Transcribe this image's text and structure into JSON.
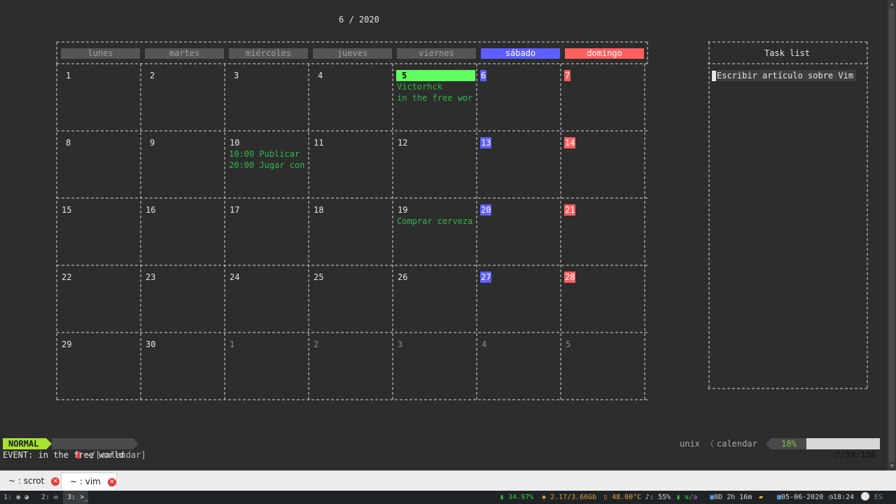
{
  "title": "6 / 2020",
  "weekdays": [
    "lunes",
    "martes",
    "miércoles",
    "jueves",
    "viernes",
    "sábado",
    "domingo"
  ],
  "weeks": [
    [
      "1",
      "2",
      "3",
      "4",
      "5",
      "6",
      "7"
    ],
    [
      "8",
      "9",
      "10",
      "11",
      "12",
      "13",
      "14"
    ],
    [
      "15",
      "16",
      "17",
      "18",
      "19",
      "20",
      "21"
    ],
    [
      "22",
      "23",
      "24",
      "25",
      "26",
      "27",
      "28"
    ],
    [
      "29",
      "30",
      "1",
      "2",
      "3",
      "4",
      "5"
    ]
  ],
  "events": {
    "day5": [
      "Victorhck",
      "in the free wor"
    ],
    "day10": [
      "10:00 Publicar",
      "20:00 Jugar con"
    ],
    "day19": [
      "Comprar cerveza"
    ]
  },
  "task_list": {
    "title": "Task list",
    "items": [
      "Escribir artículo sobre Vim"
    ]
  },
  "statusline": {
    "mode": "NORMAL",
    "file": "~/[calendar]",
    "format": "unix",
    "filetype": "calendar",
    "percent": "18%",
    "position": "7/39:136"
  },
  "cmdline": "EVENT: in the free world",
  "tabs": [
    {
      "label": "~ : scrot"
    },
    {
      "label": "~ : vim"
    }
  ],
  "panel": {
    "ws1": "1:",
    "ws2": "2:",
    "ws3": "3:",
    "battery": "34.97%",
    "memory": "2.17/3.66Gb",
    "temp": "48.00°C",
    "volume": "55%",
    "net": "a",
    "uptime": "0D 2h 16m",
    "date": "05-06-2020",
    "time": "18:24",
    "layout": "ES"
  },
  "colors": {
    "today": "#5fff5f",
    "saturday": "#5f5fff",
    "sunday": "#ff5f5f",
    "event": "#2eb84a",
    "mode": "#a6e22e"
  }
}
